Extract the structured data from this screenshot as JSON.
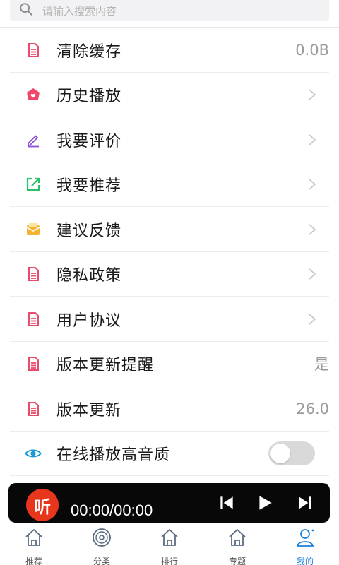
{
  "search": {
    "placeholder": "请输入搜索内容"
  },
  "menu": [
    {
      "id": "clear-cache",
      "label": "清除缓存",
      "value": "0.0B",
      "icon": "document-icon",
      "trailing": "value"
    },
    {
      "id": "history",
      "label": "历史播放",
      "icon": "history-heart-icon",
      "trailing": "chevron"
    },
    {
      "id": "review",
      "label": "我要评价",
      "icon": "pencil-icon",
      "trailing": "chevron"
    },
    {
      "id": "recommend",
      "label": "我要推荐",
      "icon": "share-box-icon",
      "trailing": "chevron"
    },
    {
      "id": "feedback",
      "label": "建议反馈",
      "icon": "mail-icon",
      "trailing": "chevron"
    },
    {
      "id": "privacy",
      "label": "隐私政策",
      "icon": "document-icon",
      "trailing": "chevron"
    },
    {
      "id": "agreement",
      "label": "用户协议",
      "icon": "document-icon",
      "trailing": "chevron"
    },
    {
      "id": "update-reminder",
      "label": "版本更新提醒",
      "value": "是",
      "icon": "document-icon",
      "trailing": "value"
    },
    {
      "id": "version",
      "label": "版本更新",
      "value": "26.0",
      "icon": "document-icon",
      "trailing": "value"
    },
    {
      "id": "hq-playback",
      "label": "在线播放高音质",
      "icon": "eye-icon",
      "trailing": "toggle",
      "toggle_on": false
    }
  ],
  "player": {
    "logo_text": "听",
    "time": "00:00/00:00"
  },
  "tabs": [
    {
      "label": "推荐",
      "icon": "home-icon",
      "active": false
    },
    {
      "label": "分类",
      "icon": "disc-icon",
      "active": false
    },
    {
      "label": "排行",
      "icon": "home-icon",
      "active": false
    },
    {
      "label": "专题",
      "icon": "home-icon",
      "active": false
    },
    {
      "label": "我的",
      "icon": "user-icon",
      "active": true
    }
  ],
  "colors": {
    "doc_icon": "#e84c6a",
    "history_icon": "#f0466a",
    "pencil_icon": "#8a4fd6",
    "share_icon": "#2bbf6a",
    "mail_icon": "#f5b331",
    "eye_icon": "#1a9ad6",
    "player_logo": "#e8361c",
    "tab_active": "#1c7fd8",
    "tab_inactive": "#5b6b80"
  }
}
